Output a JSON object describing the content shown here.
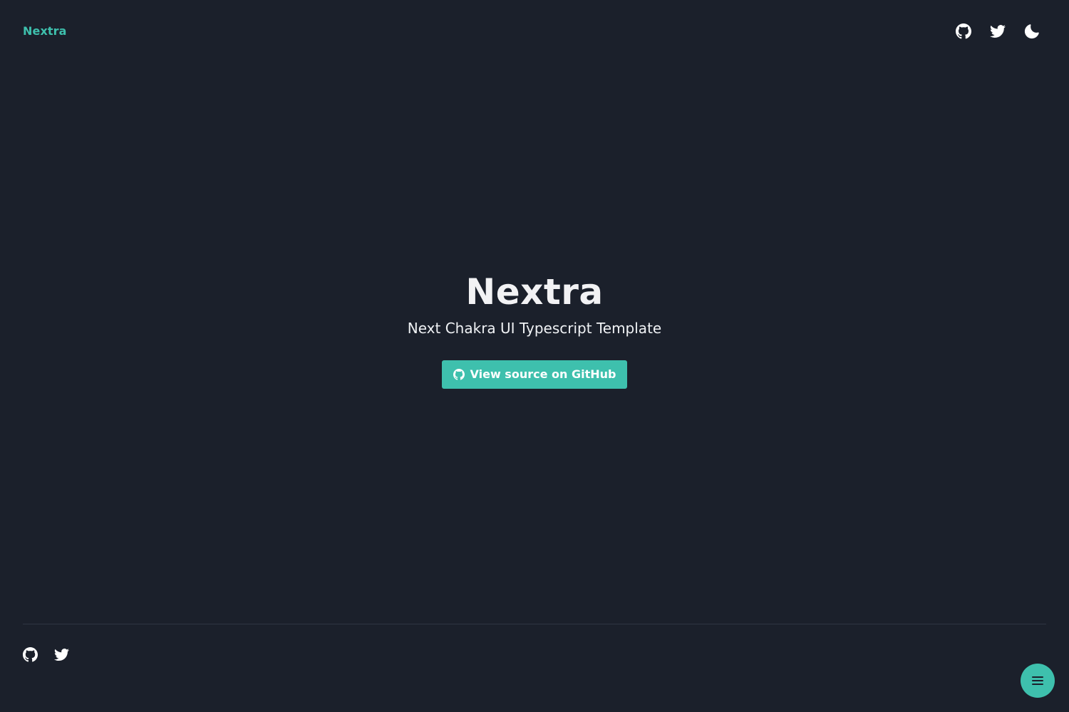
{
  "header": {
    "brand": "Nextra",
    "icons": [
      "github-icon",
      "twitter-icon",
      "moon-icon"
    ]
  },
  "hero": {
    "title": "Nextra",
    "subtitle": "Next Chakra UI Typescript Template",
    "cta_label": "View source on GitHub",
    "cta_icon": "github-icon"
  },
  "footer": {
    "icons": [
      "github-icon",
      "twitter-icon"
    ]
  },
  "fab": {
    "icon": "menu-icon"
  },
  "colors": {
    "background": "#1b202b",
    "accent": "#3ec0ad",
    "text": "#f0f2f5",
    "divider": "#2f3542"
  }
}
